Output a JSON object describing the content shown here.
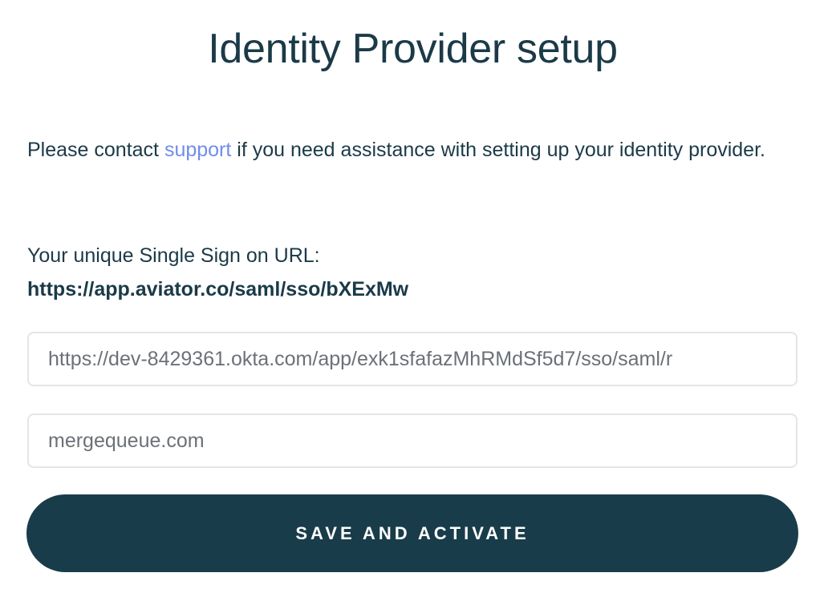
{
  "header": {
    "title": "Identity Provider setup"
  },
  "help": {
    "prefix": "Please contact ",
    "link_label": "support",
    "suffix": " if you need assistance with setting up your identity provider."
  },
  "sso": {
    "label": "Your unique Single Sign on URL:",
    "url": "https://app.aviator.co/saml/sso/bXExMw"
  },
  "form": {
    "idp_url_value": "https://dev-8429361.okta.com/app/exk1sfafazMhRMdSf5d7/sso/saml/r",
    "domain_value": "mergequeue.com",
    "submit_label": "SAVE AND ACTIVATE"
  },
  "colors": {
    "text": "#1b3a48",
    "link": "#6f8ee8",
    "button_bg": "#193c4a",
    "button_text": "#ffffff",
    "field_border": "#e3e5e8"
  }
}
